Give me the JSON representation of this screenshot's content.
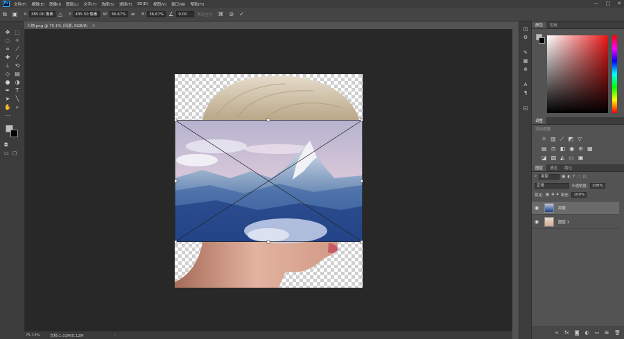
{
  "app": {
    "logo": "Ps"
  },
  "menu": [
    "文件(F)",
    "编辑(E)",
    "图像(I)",
    "图层(L)",
    "文字(Y)",
    "选择(S)",
    "滤镜(T)",
    "3D(D)",
    "视图(V)",
    "窗口(W)",
    "帮助(H)"
  ],
  "window_controls": {
    "minimize": "—",
    "maximize": "□",
    "close": "✕"
  },
  "options": {
    "x_label": "X:",
    "x_value": "385.00 像素",
    "y_label": "Y:",
    "y_value": "435.50 像素",
    "w_label": "W:",
    "w_value": "36.67%",
    "h_label": "H:",
    "h_value": "36.67%",
    "angle_value": "0.00",
    "interp_label": "两次立方"
  },
  "document": {
    "tab_title": "人物.png @ 75.1% (风景, RGB/8)",
    "close_glyph": "×"
  },
  "status": {
    "zoom": "75.13%",
    "doc_info": "文档:1.03M/5.12M",
    "arrow": "›"
  },
  "panels": {
    "color_tabs": [
      "颜色",
      "色板"
    ],
    "adjust_tab": "调整",
    "adjust_hint": "添加调整",
    "layers_tabs": [
      "图层",
      "通道",
      "路径"
    ],
    "layers": {
      "kind_label": "类型",
      "blend_mode": "正常",
      "opacity_label": "不透明度:",
      "opacity_value": "100%",
      "lock_label": "锁定:",
      "fill_label": "填充:",
      "fill_value": "100%",
      "items": [
        {
          "name": "风景",
          "selected": true
        },
        {
          "name": "图层 1",
          "selected": false
        }
      ]
    }
  },
  "colors": {
    "accent": "#31a8ff",
    "app_bg": "#535353",
    "canvas_bg": "#282828"
  }
}
